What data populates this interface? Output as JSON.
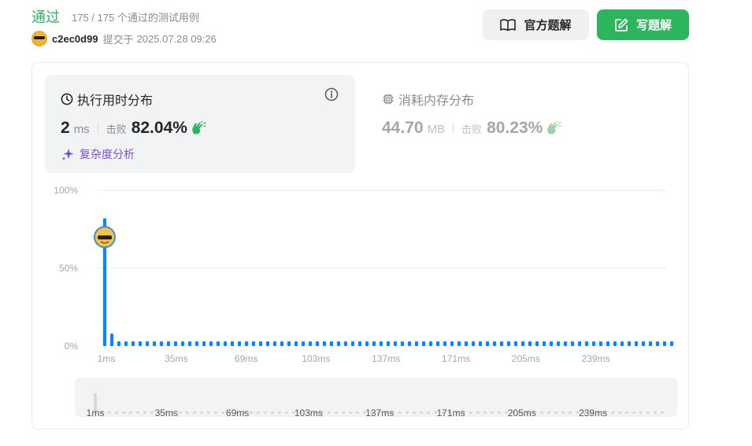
{
  "header": {
    "status": "通过",
    "cases": "175 / 175 个通过的测试用例",
    "username": "c2ec0d99",
    "submit_prefix": "提交于",
    "submit_time": "2025.07.28 09:26",
    "official_solution_label": "官方题解",
    "write_solution_label": "写题解"
  },
  "runtime": {
    "title": "执行用时分布",
    "value": "2",
    "unit": "ms",
    "beats_label": "击败",
    "beats_value": "82.04%",
    "complexity_label": "复杂度分析"
  },
  "memory": {
    "title": "消耗内存分布",
    "value": "44.70",
    "unit": "MB",
    "beats_label": "击败",
    "beats_value": "80.23%"
  },
  "colors": {
    "accent_green": "#2db55d",
    "bar_blue": "#0a84ff",
    "purple": "#7b4fd6"
  },
  "chart_data": {
    "type": "bar",
    "ytick_labels": [
      "100%",
      "50%",
      "0%"
    ],
    "ylim": [
      0,
      100
    ],
    "xtick_labels": [
      "1ms",
      "35ms",
      "69ms",
      "103ms",
      "137ms",
      "171ms",
      "205ms",
      "239ms"
    ],
    "minimap_tick_labels": [
      "1ms",
      "35ms",
      "69ms",
      "103ms",
      "137ms",
      "171ms",
      "205ms",
      "239ms"
    ],
    "highlight_index": 0,
    "highlight_value": 70,
    "values": [
      82,
      8,
      3,
      3,
      3,
      3,
      3,
      3,
      3,
      3,
      3,
      3,
      3,
      3,
      3,
      3,
      3,
      3,
      3,
      3,
      3,
      3,
      3,
      3,
      3,
      3,
      3,
      3,
      3,
      3,
      3,
      3,
      3,
      3,
      3,
      3,
      3,
      3,
      3,
      3,
      3,
      3,
      3,
      3,
      3,
      3,
      3,
      3,
      3,
      3,
      3,
      3,
      3,
      3,
      3,
      3,
      3,
      3,
      3,
      3,
      3,
      3,
      3,
      3,
      3,
      3,
      3,
      3,
      3,
      3,
      3,
      3,
      3,
      3,
      3,
      3,
      3,
      3,
      3,
      3,
      3
    ]
  }
}
